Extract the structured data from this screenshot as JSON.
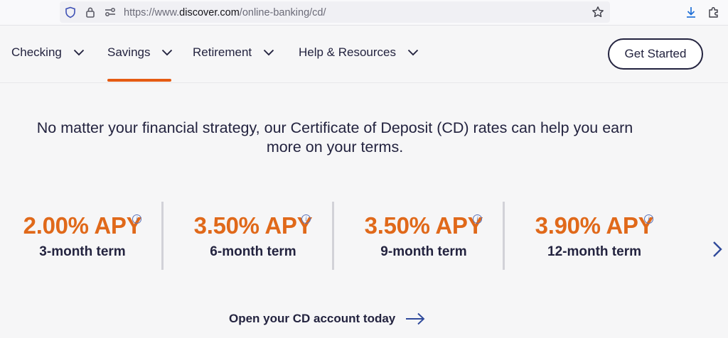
{
  "browser": {
    "url_prefix": "https://www.",
    "url_host": "discover.com",
    "url_path": "/online-banking/cd/",
    "icons": [
      "shield-icon",
      "lock-icon",
      "permissions-icon",
      "bookmark-star-icon",
      "download-icon",
      "extensions-icon"
    ]
  },
  "nav": {
    "items": [
      {
        "label": "Checking"
      },
      {
        "label": "Savings"
      },
      {
        "label": "Retirement"
      },
      {
        "label": "Help & Resources"
      }
    ],
    "active": "Savings",
    "cta_label": "Get Started",
    "accent_color": "#e55b13"
  },
  "headline": {
    "line1": "No matter your financial strategy, our Certificate of Deposit (CD) rates can help you earn",
    "line2": "more on your terms."
  },
  "rates": [
    {
      "apy": "2.00% APY",
      "term": "3-month term"
    },
    {
      "apy": "3.50% APY",
      "term": "6-month term"
    },
    {
      "apy": "3.50% APY",
      "term": "9-month term"
    },
    {
      "apy": "3.90% APY",
      "term": "12-month term"
    }
  ],
  "rate_color": "#e0691a",
  "info_glyph": "i",
  "cta": {
    "label": "Open your CD account today"
  }
}
